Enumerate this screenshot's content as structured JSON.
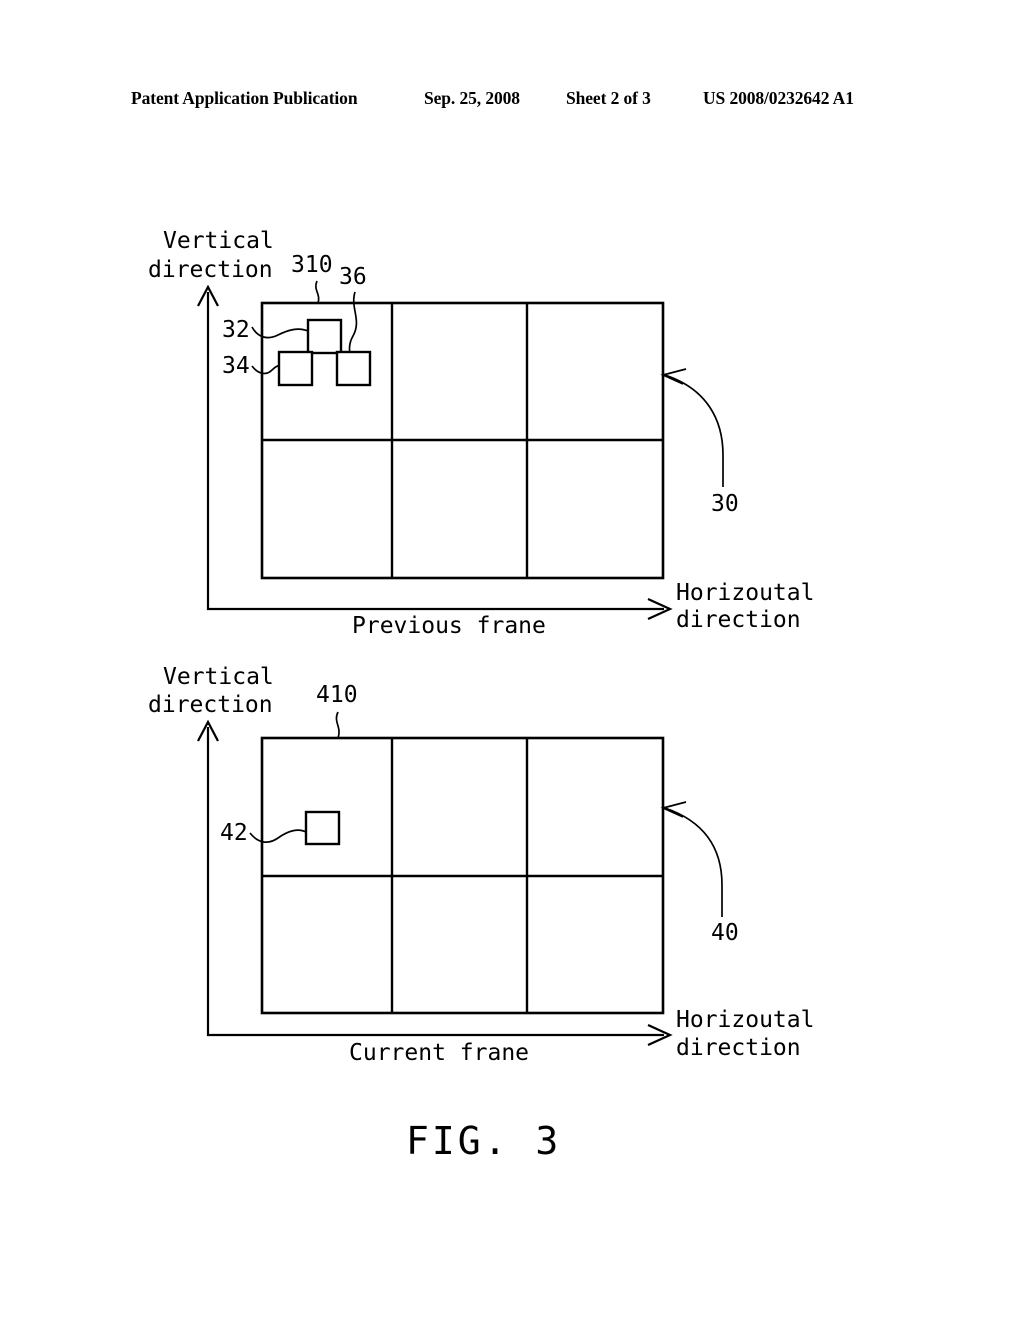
{
  "header": {
    "publication": "Patent Application Publication",
    "date": "Sep. 25, 2008",
    "sheet": "Sheet 2 of 3",
    "document_number": "US 2008/0232642 A1"
  },
  "figure": {
    "caption": "FIG.  3"
  },
  "top_diagram": {
    "frame_caption": "Previous frane",
    "vertical_axis_line1": "Vertical",
    "vertical_axis_line2": "direction",
    "horizontal_axis_line1": "Horizoutal",
    "horizontal_axis_line2": "direction",
    "frame_ref": "30",
    "macroblock_ref": "310",
    "block_upper_ref": "32",
    "block_lower_left_ref": "34",
    "block_lower_right_ref": "36",
    "grid_columns": 3,
    "grid_rows": 2
  },
  "bottom_diagram": {
    "frame_caption": "Current frane",
    "vertical_axis_line1": "Vertical",
    "vertical_axis_line2": "direction",
    "horizontal_axis_line1": "Horizoutal",
    "horizontal_axis_line2": "direction",
    "frame_ref": "40",
    "macroblock_ref": "410",
    "block_ref": "42",
    "grid_columns": 3,
    "grid_rows": 2
  }
}
